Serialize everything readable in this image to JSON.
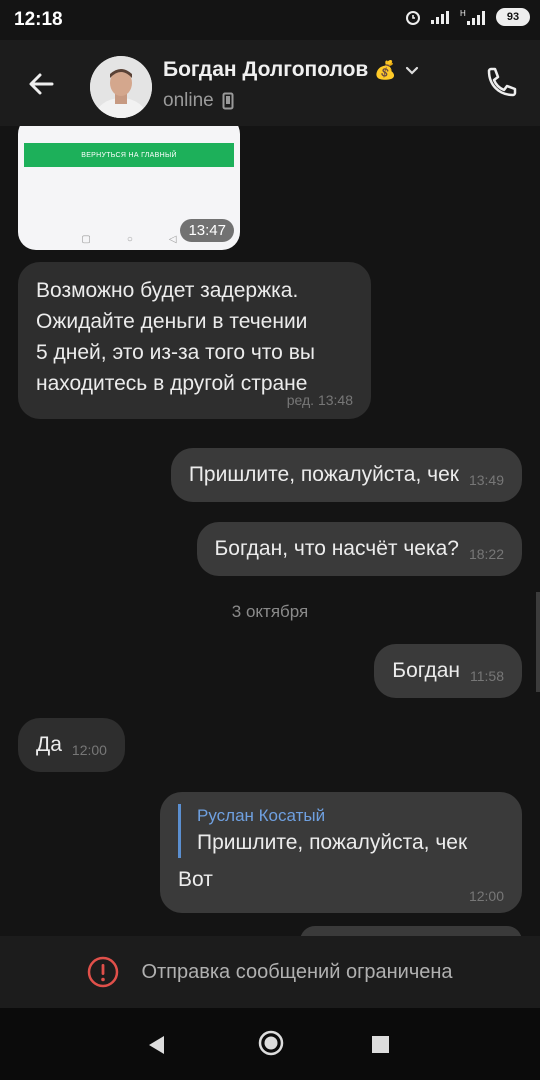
{
  "status_bar": {
    "time": "12:18",
    "battery": "93"
  },
  "header": {
    "contact_name": "Богдан Долгополов",
    "status": "online",
    "icons": [
      "back-arrow-icon",
      "money-bag-icon",
      "chevron-down-icon",
      "phone-icon",
      "mobile-device-icon"
    ]
  },
  "messages": {
    "image_button_text": "ВЕРНУТЬСЯ НА ГЛАВНЫЙ",
    "image_time": "13:47",
    "m1": {
      "lines": [
        "Возможно будет задержка.",
        "Ожидайте деньги в течении",
        "5 дней, это из-за того что вы",
        "находитесь в другой стране"
      ],
      "time": "ред. 13:48"
    },
    "m2": {
      "text": "Пришлите, пожалуйста, чек",
      "time": "13:49"
    },
    "m3": {
      "text": "Богдан, что насчёт чека?",
      "time": "18:22"
    },
    "date_separator": "3 октября",
    "m4": {
      "text": "Богдан",
      "time": "11:58"
    },
    "m5": {
      "text": "Да",
      "time": "12:00"
    },
    "m6": {
      "reply_author": "Руслан Косатый",
      "reply_text": "Пришлите, пожалуйста, чек",
      "text": "Вот",
      "time": "12:00"
    }
  },
  "restricted": {
    "text": "Отправка сообщений ограничена"
  },
  "colors": {
    "background": "#141414",
    "bubble": "#2e2e2e",
    "accent": "#6fa0e0",
    "warning": "#e0504a"
  }
}
